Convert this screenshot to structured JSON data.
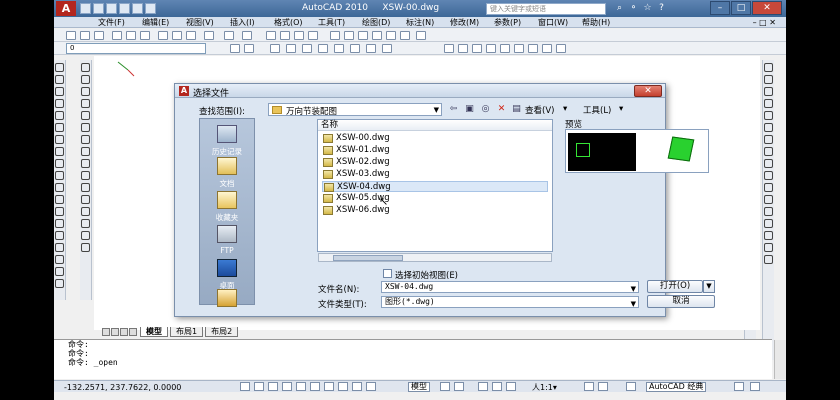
{
  "window": {
    "title": "AutoCAD 2010",
    "file": "XSW-00.dwg",
    "search_placeholder": "键入关键字或短语",
    "app_logo": "A"
  },
  "menu": {
    "items": [
      "文件(F)",
      "编辑(E)",
      "视图(V)",
      "插入(I)",
      "格式(O)",
      "工具(T)",
      "绘图(D)",
      "标注(N)",
      "修改(M)",
      "参数(P)",
      "窗口(W)",
      "帮助(H)"
    ]
  },
  "toolbar": {
    "layer_value": "0",
    "scale_value": "1:1"
  },
  "canvas": {
    "tabs": [
      "模型",
      "布局1",
      "布局2"
    ]
  },
  "command": {
    "lines": [
      "命令:",
      "命令:",
      "命令:  _open"
    ]
  },
  "status": {
    "coords": "-132.2571, 237.7622, 0.0000",
    "model_label": "模型",
    "scale": "人1:1▾",
    "workspace": "AutoCAD 经典"
  },
  "dialog": {
    "title": "选择文件",
    "lookin_label": "查找范围(I):",
    "lookin_value": "万向节装配图",
    "view_menu": "查看(V)",
    "tools_menu": "工具(L)",
    "places": [
      {
        "label": "历史记录",
        "icon": "history-icon"
      },
      {
        "label": "文档",
        "icon": "documents-icon"
      },
      {
        "label": "收藏夹",
        "icon": "favorites-icon"
      },
      {
        "label": "FTP",
        "icon": "ftp-icon"
      },
      {
        "label": "桌面",
        "icon": "desktop-icon"
      }
    ],
    "column_name": "名称",
    "files": [
      "XSW-00.dwg",
      "XSW-01.dwg",
      "XSW-02.dwg",
      "XSW-03.dwg",
      "XSW-04.dwg",
      "XSW-05.dwg",
      "XSW-06.dwg"
    ],
    "selected_index": 4,
    "preview_label": "预览",
    "initial_view_label": "选择初始视图(E)",
    "filename_label": "文件名(N):",
    "filename_value": "XSW-04.dwg",
    "filetype_label": "文件类型(T):",
    "filetype_value": "图形(*.dwg)",
    "open_button": "打开(O)",
    "cancel_button": "取消"
  }
}
